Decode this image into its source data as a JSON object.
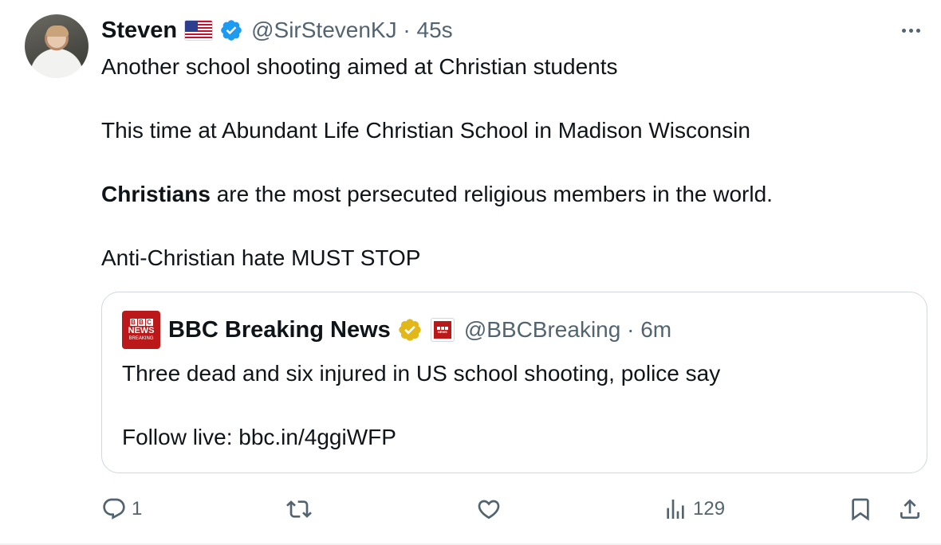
{
  "tweet": {
    "author_name": "Steven",
    "handle": "@SirStevenKJ",
    "time": "45s",
    "separator": "·",
    "icons": {
      "flag": "us-flag-icon",
      "verified": "verified-badge-icon",
      "more": "more-icon"
    },
    "verified_color": "#1d9bf0",
    "body": {
      "line1": "Another school shooting aimed at Christian students",
      "line2": "This time at Abundant Life Christian School in Madison Wisconsin",
      "line3_bold": "Christians",
      "line3_rest": " are the most persecuted religious members in the world.",
      "line4": "Anti-Christian hate MUST STOP"
    }
  },
  "quote": {
    "author_name": "BBC Breaking News",
    "handle": "@BBCBreaking",
    "time": "6m",
    "separator": "·",
    "logo": {
      "blocks": [
        "B",
        "B",
        "C"
      ],
      "news": "NEWS",
      "breaking": "BREAKING"
    },
    "badge_color": "#e2b719",
    "logo_color": "#bb1919",
    "text1": "Three dead and six injured in US school shooting, police say",
    "text2": "Follow live: bbc.in/4ggiWFP"
  },
  "actions": {
    "reply_count": "1",
    "retweet_count": "",
    "like_count": "",
    "views_count": "129"
  }
}
